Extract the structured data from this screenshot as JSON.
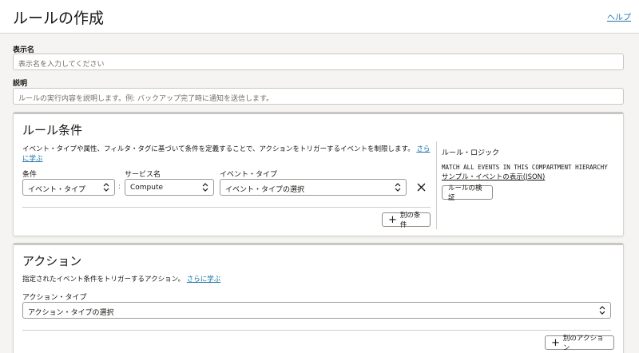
{
  "header": {
    "title": "ルールの作成",
    "help": "ヘルプ"
  },
  "display_name": {
    "label": "表示名",
    "placeholder": "表示名を入力してください"
  },
  "description": {
    "label": "説明",
    "placeholder": "ルールの実行内容を説明します。例: バックアップ完了時に通知を送信します。"
  },
  "conditions": {
    "title": "ルール条件",
    "desc": "イベント・タイプや属性、フィルタ・タグに基づいて条件を定義することで、アクションをトリガーするイベントを制限します。",
    "learn_more": "さらに学ぶ",
    "condition_label": "条件",
    "condition_value": "イベント・タイプ",
    "separator": ":",
    "service_label": "サービス名",
    "service_value": "Compute",
    "event_type_label": "イベント・タイプ",
    "event_type_value": "イベント・タイプの選択",
    "add_condition": "別の条件",
    "logic_title": "ルール・ロジック",
    "logic_text": "MATCH ALL EVENTS IN THIS COMPARTMENT HIERARCHY",
    "sample_events_link": "サンプル・イベントの表示(JSON)",
    "validate_button": "ルールの検証"
  },
  "actions": {
    "title": "アクション",
    "desc": "指定されたイベント条件をトリガーするアクション。",
    "learn_more": "さらに学ぶ",
    "action_type_label": "アクション・タイプ",
    "action_type_value": "アクション・タイプの選択",
    "add_action": "別のアクション"
  }
}
